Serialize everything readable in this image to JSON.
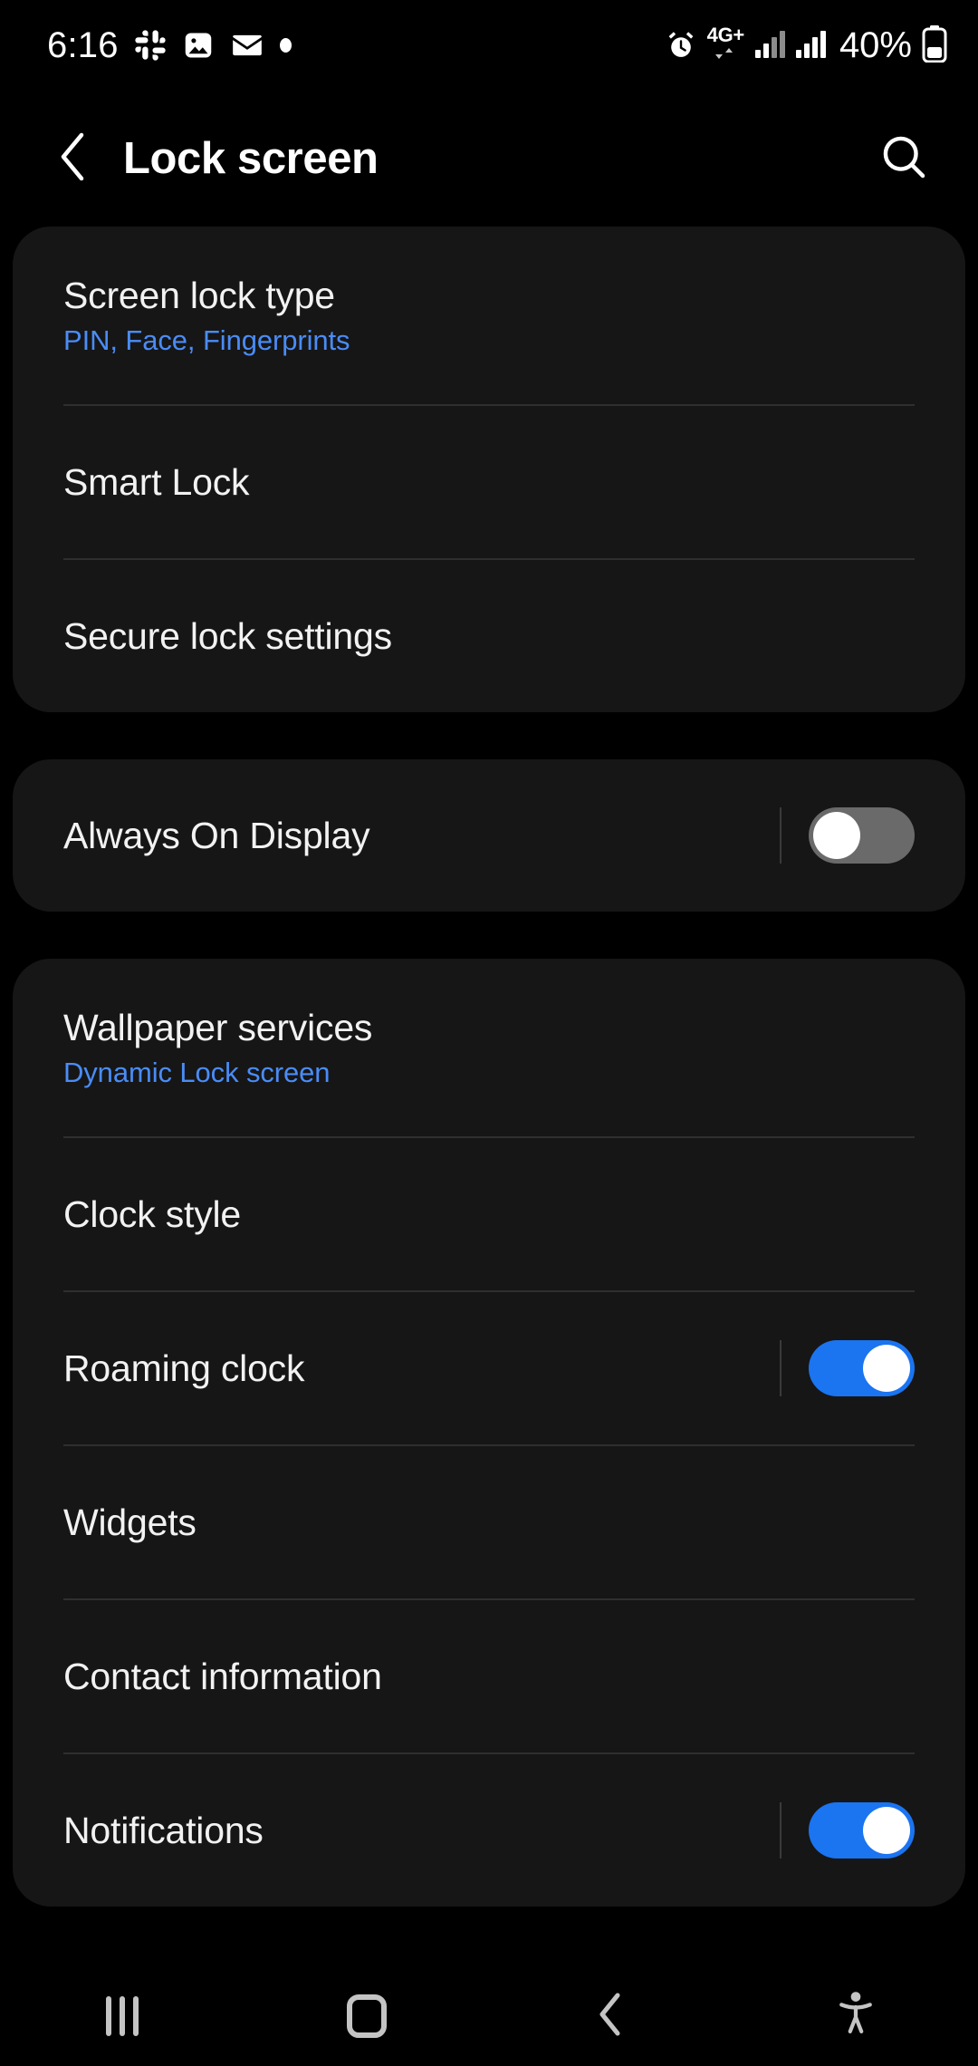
{
  "status_bar": {
    "time": "6:16",
    "left_icons": [
      "slack-icon",
      "photos-icon",
      "mail-icon",
      "dot-icon"
    ],
    "alarm_icon": "alarm-icon",
    "network_type": "4G+",
    "data_arrows": "down-up-arrows-icon",
    "signal_icons": [
      "signal-bars-sim1-icon",
      "signal-bars-sim2-icon"
    ],
    "battery_percent": "40%",
    "battery_icon": "battery-icon"
  },
  "header": {
    "back_icon": "chevron-left-icon",
    "title": "Lock screen",
    "search_icon": "search-icon"
  },
  "colors": {
    "accent_blue": "#4a8cf7",
    "toggle_on": "#1b74f0",
    "toggle_off": "#6a6a6a",
    "card_bg": "#161616",
    "page_bg": "#000000"
  },
  "groups": [
    {
      "name": "security-group",
      "rows": [
        {
          "name": "screen-lock-type",
          "title": "Screen lock type",
          "subtitle": "PIN, Face, Fingerprints",
          "toggle": null
        },
        {
          "name": "smart-lock",
          "title": "Smart Lock",
          "subtitle": null,
          "toggle": null
        },
        {
          "name": "secure-lock-settings",
          "title": "Secure lock settings",
          "subtitle": null,
          "toggle": null
        }
      ]
    },
    {
      "name": "always-on-display-group",
      "rows": [
        {
          "name": "always-on-display",
          "title": "Always On Display",
          "subtitle": null,
          "toggle": "off"
        }
      ]
    },
    {
      "name": "appearance-group",
      "rows": [
        {
          "name": "wallpaper-services",
          "title": "Wallpaper services",
          "subtitle": "Dynamic Lock screen",
          "toggle": null
        },
        {
          "name": "clock-style",
          "title": "Clock style",
          "subtitle": null,
          "toggle": null
        },
        {
          "name": "roaming-clock",
          "title": "Roaming clock",
          "subtitle": null,
          "toggle": "on"
        },
        {
          "name": "widgets",
          "title": "Widgets",
          "subtitle": null,
          "toggle": null
        },
        {
          "name": "contact-information",
          "title": "Contact information",
          "subtitle": null,
          "toggle": null
        },
        {
          "name": "notifications",
          "title": "Notifications",
          "subtitle": null,
          "toggle": "on"
        }
      ]
    }
  ],
  "nav_bar": {
    "recents_label": "recents-icon",
    "home_label": "home-icon",
    "back_label": "back-icon",
    "accessibility_label": "accessibility-icon"
  }
}
